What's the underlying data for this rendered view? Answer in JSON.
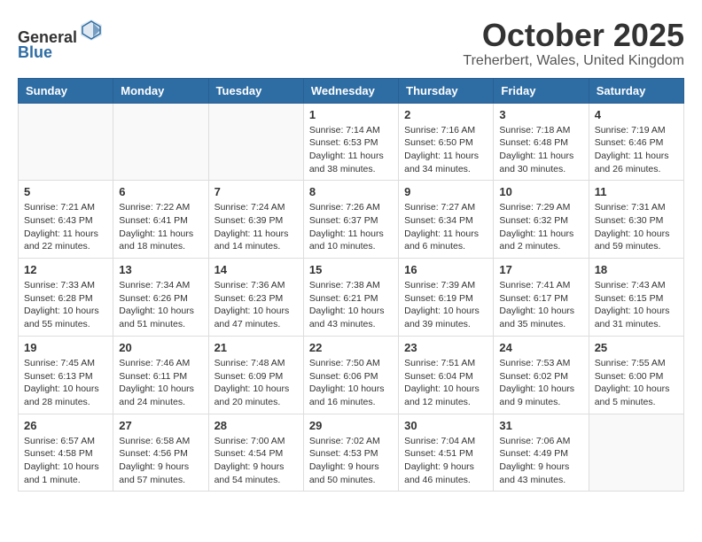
{
  "header": {
    "logo_general": "General",
    "logo_blue": "Blue",
    "month_title": "October 2025",
    "location": "Treherbert, Wales, United Kingdom"
  },
  "days_of_week": [
    "Sunday",
    "Monday",
    "Tuesday",
    "Wednesday",
    "Thursday",
    "Friday",
    "Saturday"
  ],
  "weeks": [
    [
      {
        "day": "",
        "info": ""
      },
      {
        "day": "",
        "info": ""
      },
      {
        "day": "",
        "info": ""
      },
      {
        "day": "1",
        "info": "Sunrise: 7:14 AM\nSunset: 6:53 PM\nDaylight: 11 hours\nand 38 minutes."
      },
      {
        "day": "2",
        "info": "Sunrise: 7:16 AM\nSunset: 6:50 PM\nDaylight: 11 hours\nand 34 minutes."
      },
      {
        "day": "3",
        "info": "Sunrise: 7:18 AM\nSunset: 6:48 PM\nDaylight: 11 hours\nand 30 minutes."
      },
      {
        "day": "4",
        "info": "Sunrise: 7:19 AM\nSunset: 6:46 PM\nDaylight: 11 hours\nand 26 minutes."
      }
    ],
    [
      {
        "day": "5",
        "info": "Sunrise: 7:21 AM\nSunset: 6:43 PM\nDaylight: 11 hours\nand 22 minutes."
      },
      {
        "day": "6",
        "info": "Sunrise: 7:22 AM\nSunset: 6:41 PM\nDaylight: 11 hours\nand 18 minutes."
      },
      {
        "day": "7",
        "info": "Sunrise: 7:24 AM\nSunset: 6:39 PM\nDaylight: 11 hours\nand 14 minutes."
      },
      {
        "day": "8",
        "info": "Sunrise: 7:26 AM\nSunset: 6:37 PM\nDaylight: 11 hours\nand 10 minutes."
      },
      {
        "day": "9",
        "info": "Sunrise: 7:27 AM\nSunset: 6:34 PM\nDaylight: 11 hours\nand 6 minutes."
      },
      {
        "day": "10",
        "info": "Sunrise: 7:29 AM\nSunset: 6:32 PM\nDaylight: 11 hours\nand 2 minutes."
      },
      {
        "day": "11",
        "info": "Sunrise: 7:31 AM\nSunset: 6:30 PM\nDaylight: 10 hours\nand 59 minutes."
      }
    ],
    [
      {
        "day": "12",
        "info": "Sunrise: 7:33 AM\nSunset: 6:28 PM\nDaylight: 10 hours\nand 55 minutes."
      },
      {
        "day": "13",
        "info": "Sunrise: 7:34 AM\nSunset: 6:26 PM\nDaylight: 10 hours\nand 51 minutes."
      },
      {
        "day": "14",
        "info": "Sunrise: 7:36 AM\nSunset: 6:23 PM\nDaylight: 10 hours\nand 47 minutes."
      },
      {
        "day": "15",
        "info": "Sunrise: 7:38 AM\nSunset: 6:21 PM\nDaylight: 10 hours\nand 43 minutes."
      },
      {
        "day": "16",
        "info": "Sunrise: 7:39 AM\nSunset: 6:19 PM\nDaylight: 10 hours\nand 39 minutes."
      },
      {
        "day": "17",
        "info": "Sunrise: 7:41 AM\nSunset: 6:17 PM\nDaylight: 10 hours\nand 35 minutes."
      },
      {
        "day": "18",
        "info": "Sunrise: 7:43 AM\nSunset: 6:15 PM\nDaylight: 10 hours\nand 31 minutes."
      }
    ],
    [
      {
        "day": "19",
        "info": "Sunrise: 7:45 AM\nSunset: 6:13 PM\nDaylight: 10 hours\nand 28 minutes."
      },
      {
        "day": "20",
        "info": "Sunrise: 7:46 AM\nSunset: 6:11 PM\nDaylight: 10 hours\nand 24 minutes."
      },
      {
        "day": "21",
        "info": "Sunrise: 7:48 AM\nSunset: 6:09 PM\nDaylight: 10 hours\nand 20 minutes."
      },
      {
        "day": "22",
        "info": "Sunrise: 7:50 AM\nSunset: 6:06 PM\nDaylight: 10 hours\nand 16 minutes."
      },
      {
        "day": "23",
        "info": "Sunrise: 7:51 AM\nSunset: 6:04 PM\nDaylight: 10 hours\nand 12 minutes."
      },
      {
        "day": "24",
        "info": "Sunrise: 7:53 AM\nSunset: 6:02 PM\nDaylight: 10 hours\nand 9 minutes."
      },
      {
        "day": "25",
        "info": "Sunrise: 7:55 AM\nSunset: 6:00 PM\nDaylight: 10 hours\nand 5 minutes."
      }
    ],
    [
      {
        "day": "26",
        "info": "Sunrise: 6:57 AM\nSunset: 4:58 PM\nDaylight: 10 hours\nand 1 minute."
      },
      {
        "day": "27",
        "info": "Sunrise: 6:58 AM\nSunset: 4:56 PM\nDaylight: 9 hours\nand 57 minutes."
      },
      {
        "day": "28",
        "info": "Sunrise: 7:00 AM\nSunset: 4:54 PM\nDaylight: 9 hours\nand 54 minutes."
      },
      {
        "day": "29",
        "info": "Sunrise: 7:02 AM\nSunset: 4:53 PM\nDaylight: 9 hours\nand 50 minutes."
      },
      {
        "day": "30",
        "info": "Sunrise: 7:04 AM\nSunset: 4:51 PM\nDaylight: 9 hours\nand 46 minutes."
      },
      {
        "day": "31",
        "info": "Sunrise: 7:06 AM\nSunset: 4:49 PM\nDaylight: 9 hours\nand 43 minutes."
      },
      {
        "day": "",
        "info": ""
      }
    ]
  ]
}
